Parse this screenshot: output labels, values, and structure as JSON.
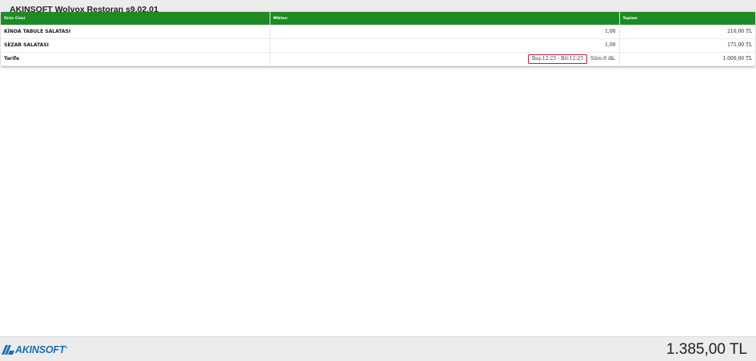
{
  "app": {
    "title": "AKINSOFT Wolvox Restoran s9.02.01"
  },
  "table": {
    "columns": [
      "Ürün Cinsi",
      "Miktarı",
      "Toplam"
    ],
    "rows": [
      {
        "name": "KİNOA TABULE SALATASI",
        "quantity": "1,00",
        "total": "210,00 TL"
      },
      {
        "name": "SEZAR SALATASI",
        "quantity": "1,00",
        "total": "175,00 TL"
      },
      {
        "name": "Tarife",
        "time_range": "Baş:12:25 - Bit:12:25",
        "duration": "Süre:0 dk.",
        "total": "1.000,00 TL"
      }
    ]
  },
  "footer": {
    "logo_text": "AKINSOFT",
    "logo_reg": "®",
    "grand_total": "1.385,00 TL"
  },
  "colors": {
    "header_green": "#1e8a24",
    "logo_blue": "#1b6fb4",
    "highlight_red": "#c8193d"
  }
}
